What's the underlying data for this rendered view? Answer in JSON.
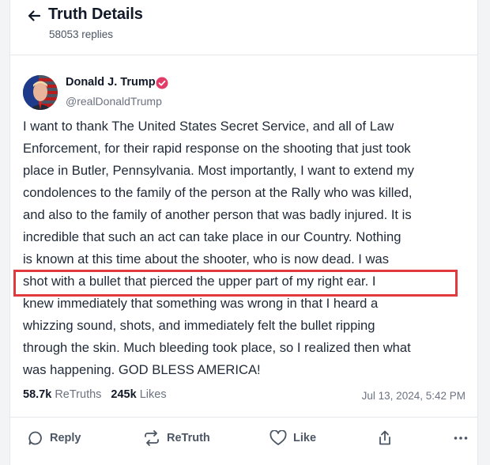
{
  "header": {
    "title": "Truth Details",
    "reply_count": "58053 replies"
  },
  "author": {
    "name": "Donald J. Trump",
    "handle": "@realDonaldTrump",
    "verified": true
  },
  "post": {
    "lines": [
      "I want to thank The United States Secret Service, and all of Law",
      "Enforcement, for their rapid response on the shooting that just took",
      "place in Butler, Pennsylvania. Most importantly, I want to extend my",
      "condolences to the family of the person at the Rally who was killed,",
      "and also to the family of another person that was badly injured. It is",
      "incredible that such an act can take place in our Country. Nothing",
      "is known at this time about the shooter, who is now dead. I was",
      "shot with a bullet that pierced the upper part of my right ear. I",
      "knew immediately that something was wrong in that I heard a",
      "whizzing sound, shots, and immediately felt the bullet ripping",
      "through the skin. Much bleeding took place, so I realized then what",
      "was happening. GOD BLESS AMERICA!"
    ]
  },
  "stats": {
    "retruths_count": "58.7k",
    "retruths_label": "ReTruths",
    "likes_count": "245k",
    "likes_label": "Likes",
    "timestamp": "Jul 13, 2024, 5:42 PM"
  },
  "actions": {
    "reply": "Reply",
    "retruth": "ReTruth",
    "like": "Like"
  },
  "colors": {
    "verified_badge": "#e23c67",
    "highlight_border": "#e0393e",
    "muted_text": "#6b7280"
  }
}
